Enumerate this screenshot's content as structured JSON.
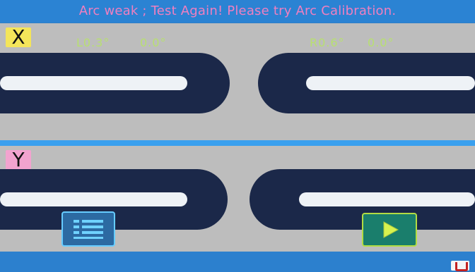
{
  "status": {
    "message": "Arc weak ; Test Again!   Please try Arc Calibration."
  },
  "views": {
    "x": {
      "axis_label": "X",
      "left_angle": "L0.3°",
      "left_offset": "0.0°",
      "right_angle": "R0.6°",
      "right_offset": "0.0°"
    },
    "y": {
      "axis_label": "Y"
    }
  },
  "controls": {
    "menu_icon": "menu-list-icon",
    "play_icon": "play-icon"
  },
  "colors": {
    "status_text": "#f07fc0",
    "readout_text": "#b8e070",
    "fiber": "#1b2849",
    "background": "#bdbdbd"
  }
}
